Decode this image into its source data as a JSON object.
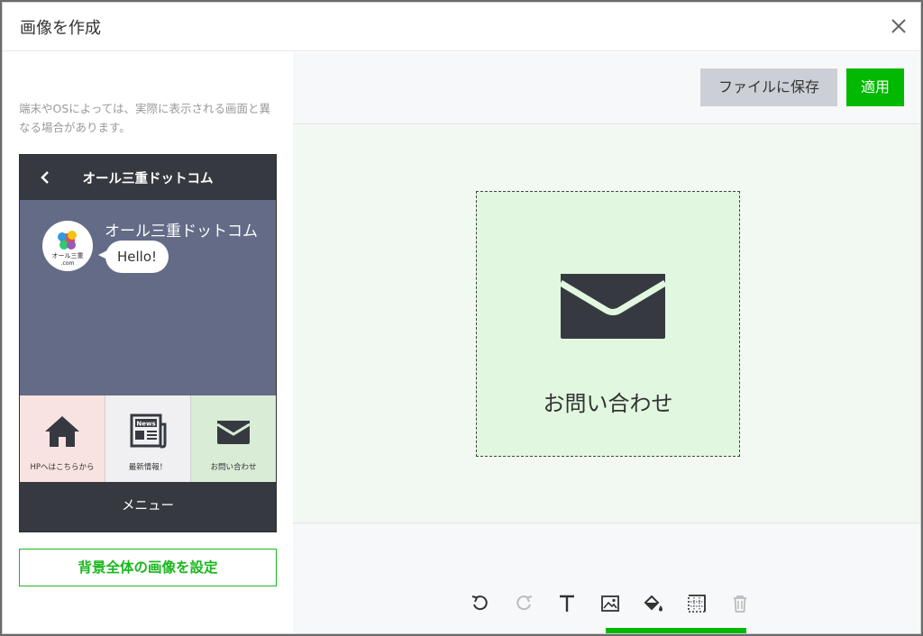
{
  "dialog": {
    "title": "画像を作成",
    "close_icon": "close-icon"
  },
  "preview": {
    "note": "端末やOSによっては、実際に表示される画面と異なる場合があります。",
    "header_title": "オール三重ドットコム",
    "bot_name": "オール三重ドットコム",
    "bubble_text": "Hello!",
    "avatar_text": "オール三重\n.com",
    "menu_tiles": [
      {
        "label": "HPへはこちらから",
        "icon": "home-icon",
        "bg": "#f8e3e1"
      },
      {
        "label": "最新情報！",
        "icon": "newspaper-icon",
        "bg": "#f0f0f2"
      },
      {
        "label": "お問い合わせ",
        "icon": "mail-icon",
        "bg": "#d8ecd6"
      }
    ],
    "news_text": "News",
    "footer_label": "メニュー"
  },
  "set_background_label": "背景全体の画像を設定",
  "toolbar": {
    "save_label": "ファイルに保存",
    "apply_label": "適用"
  },
  "canvas": {
    "label": "お問い合わせ",
    "icon": "mail-icon",
    "bg": "#e1f7df"
  },
  "tools": [
    {
      "name": "undo-icon",
      "enabled": true
    },
    {
      "name": "redo-icon",
      "enabled": false
    },
    {
      "name": "text-icon",
      "enabled": true
    },
    {
      "name": "image-icon",
      "enabled": true
    },
    {
      "name": "fill-color-icon",
      "enabled": true
    },
    {
      "name": "grid-icon",
      "enabled": true
    },
    {
      "name": "trash-icon",
      "enabled": false
    }
  ],
  "colors": {
    "accent": "#00b900",
    "phone_dark": "#363a40",
    "chat_bg": "#636b86"
  }
}
